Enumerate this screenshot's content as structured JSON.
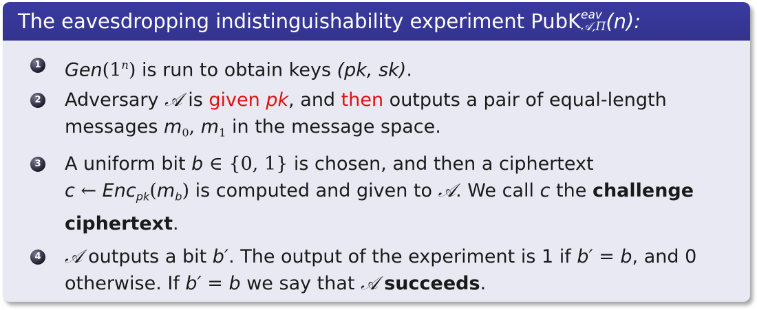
{
  "block": {
    "title_prefix": "The eavesdropping indistinguishability experiment PubK",
    "title_sup": "eav",
    "title_sub": "𝒜,Π",
    "title_arg": "(n):"
  },
  "items": [
    {
      "number": "1",
      "gen": "Gen",
      "gen_arg_open": "(1",
      "gen_arg_sup": "n",
      "gen_arg_close": ")",
      "text_a": " is run to obtain keys ",
      "keys": "(pk, sk)",
      "text_end": "."
    },
    {
      "number": "2",
      "line1_a": "Adversary ",
      "adv": "𝒜",
      "line1_b": " is ",
      "given": "given ",
      "given_pk": "pk",
      "line1_c": ", and ",
      "then": "then",
      "line1_d": " outputs a pair of equal-length",
      "line2_a": "messages ",
      "m0": "m",
      "m0_sub": "0",
      "m_sep": ", ",
      "m1": "m",
      "m1_sub": "1",
      "line2_b": " in the message space."
    },
    {
      "number": "3",
      "line1_a": "A uniform bit ",
      "bit": "b",
      "set": " ∈ {0, 1}",
      "line1_b": " is chosen, and then a ciphertext",
      "c": "c",
      "arrow": " ← ",
      "enc": "Enc",
      "enc_sub": "pk",
      "enc_open": "(",
      "mb": "m",
      "mb_sub": "b",
      "enc_close": ")",
      "line2_a": " is computed and given to ",
      "adv": "𝒜",
      "line2_b": ". We call ",
      "c2": "c",
      "line2_c": " the ",
      "challenge": "challenge",
      "ciphertext": "ciphertext",
      "line3_end": "."
    },
    {
      "number": "4",
      "adv": "𝒜",
      "line1_a": " outputs a bit ",
      "bp": "b′",
      "line1_b": ". The output of the experiment is 1 if ",
      "bp2": "b′",
      "eq": " = ",
      "b": "b",
      "line1_c": ", and 0",
      "line2_a": "otherwise. If ",
      "bp3": "b′",
      "eq2": " = ",
      "b2": "b",
      "line2_b": " we say that ",
      "adv2": "𝒜",
      "line2_c": " ",
      "succeeds": "succeeds",
      "line2_end": "."
    }
  ]
}
